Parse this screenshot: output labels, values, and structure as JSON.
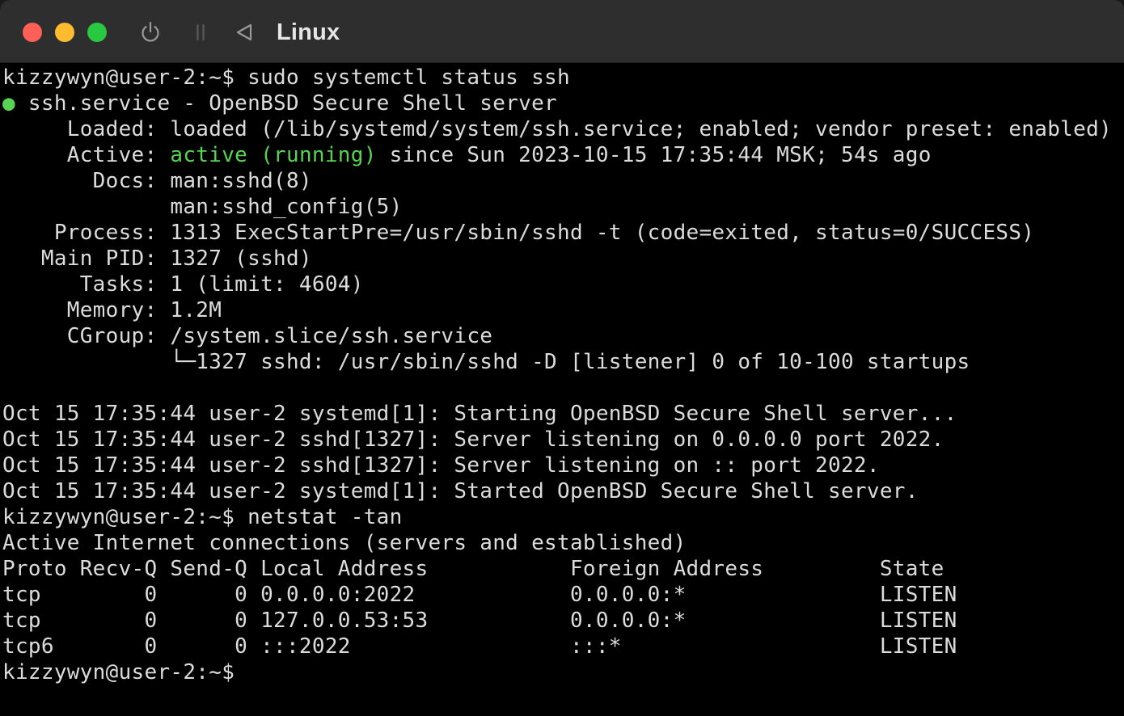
{
  "window": {
    "title": "Linux",
    "colors": {
      "close": "#fe5f57",
      "minimize": "#febc2e",
      "maximize": "#28c840",
      "terminal_bg": "#000000",
      "terminal_fg": "#dcdcdc",
      "accent_green": "#58d352"
    },
    "toolbar_icons": [
      "power-icon",
      "pause-icon",
      "back-icon"
    ]
  },
  "terminal": {
    "lines": [
      "kizzywyn@user-2:~$ sudo systemctl status ssh",
      " ssh.service - OpenBSD Secure Shell server",
      "     Loaded: loaded (/lib/systemd/system/ssh.service; enabled; vendor preset: enabled)",
      "     Active: ",
      "       Docs: man:sshd(8)",
      "             man:sshd_config(5)",
      "    Process: 1313 ExecStartPre=/usr/sbin/sshd -t (code=exited, status=0/SUCCESS)",
      "   Main PID: 1327 (sshd)",
      "      Tasks: 1 (limit: 4604)",
      "     Memory: 1.2M",
      "     CGroup: /system.slice/ssh.service",
      "             └─1327 sshd: /usr/sbin/sshd -D [listener] 0 of 10-100 startups",
      "",
      "Oct 15 17:35:44 user-2 systemd[1]: Starting OpenBSD Secure Shell server...",
      "Oct 15 17:35:44 user-2 sshd[1327]: Server listening on 0.0.0.0 port 2022.",
      "Oct 15 17:35:44 user-2 sshd[1327]: Server listening on :: port 2022.",
      "Oct 15 17:35:44 user-2 systemd[1]: Started OpenBSD Secure Shell server.",
      "kizzywyn@user-2:~$ netstat -tan",
      "Active Internet connections (servers and established)",
      "Proto Recv-Q Send-Q Local Address           Foreign Address         State",
      "tcp        0      0 0.0.0.0:2022            0.0.0.0:*               LISTEN",
      "tcp        0      0 127.0.0.53:53           0.0.0.0:*               LISTEN",
      "tcp6       0      0 :::2022                 :::*                    LISTEN",
      "kizzywyn@user-2:~$"
    ],
    "status_dot": "●",
    "active_status": "active (running)",
    "active_since": " since Sun 2023-10-15 17:35:44 MSK; 54s ago"
  }
}
